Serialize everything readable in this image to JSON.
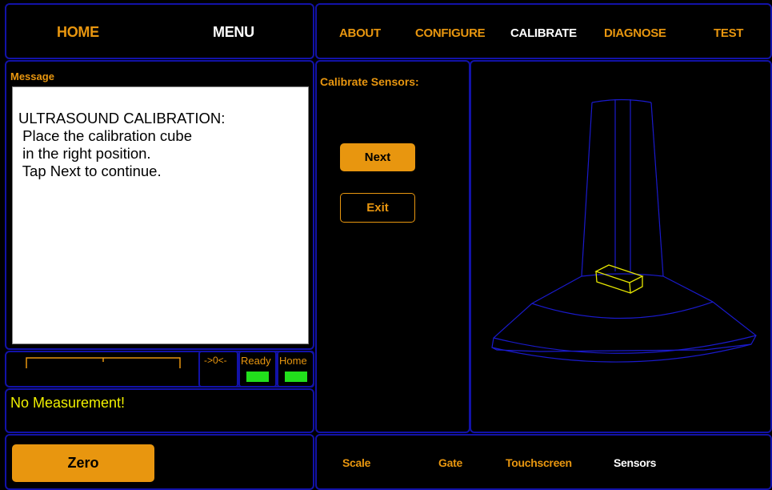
{
  "top_nav": {
    "home": "HOME",
    "menu": "MENU",
    "tabs": [
      "ABOUT",
      "CONFIGURE",
      "CALIBRATE",
      "DIAGNOSE",
      "TEST"
    ],
    "active_tab": "CALIBRATE"
  },
  "message_panel": {
    "title": "Message",
    "lines": [
      "ULTRASOUND CALIBRATION:",
      " Place the calibration cube",
      " in the right position.",
      " Tap Next to continue."
    ]
  },
  "indicators": {
    "zero_label": "->0<-",
    "ready_label": "Ready",
    "home_label": "Home",
    "lamp_color": "#22e01c"
  },
  "status": {
    "text": "No Measurement!"
  },
  "calibrate": {
    "title": "Calibrate Sensors:",
    "next_label": "Next",
    "exit_label": "Exit"
  },
  "bottom": {
    "zero_button": "Zero",
    "tabs": [
      "Scale",
      "Gate",
      "Touchscreen",
      "Sensors"
    ],
    "active_tab": "Sensors"
  },
  "colors": {
    "accent": "#e8960f",
    "border": "#1212a8",
    "model_wire": "#1a1acc",
    "cube_wire": "#e6e600"
  }
}
